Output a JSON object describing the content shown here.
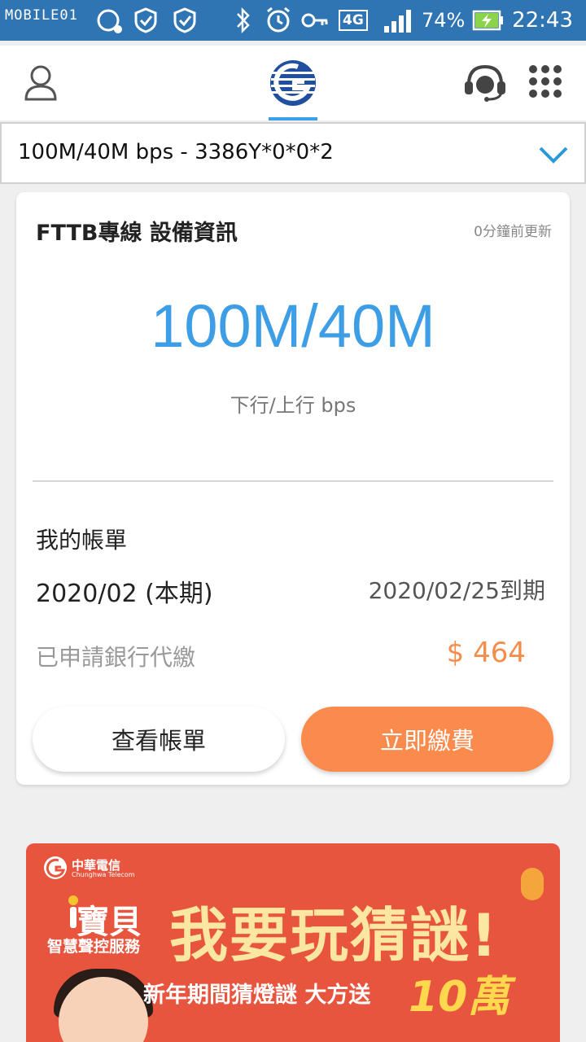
{
  "status_bar": {
    "watermark": "MOBILE01",
    "network": "4G",
    "battery": "74%",
    "time": "22:43"
  },
  "app_header": {
    "account_icon": "person-icon",
    "logo": "chunghwa-telecom-logo",
    "support_icon": "headset-icon",
    "menu_icon": "grid-menu-icon"
  },
  "plan_select": {
    "value": "100M/40M bps - 3386Y*0*0*2",
    "icon": "chevron-down-icon"
  },
  "device_card": {
    "title": "FTTB專線 設備資訊",
    "updated": "0分鐘前更新",
    "speed": "100M/40M",
    "speed_label": "下行/上行 bps"
  },
  "bill": {
    "title": "我的帳單",
    "period": "2020/02 (本期)",
    "due": "2020/02/25到期",
    "status": "已申請銀行代繳",
    "amount": "$ 464",
    "view_button": "查看帳單",
    "pay_button": "立即繳費"
  },
  "banner": {
    "brand": "中華電信",
    "brand_en": "Chunghwa Telecom",
    "product": "寶貝",
    "product_sub": "智慧聲控服務",
    "headline": "我要玩猜謎!",
    "sub": "新年期間猜燈謎 大方送",
    "big": "10萬"
  },
  "colors": {
    "status_bar": "#2f74b3",
    "accent_blue": "#3d9ee6",
    "accent_orange": "#fb8a4d",
    "banner_red": "#e8553e"
  }
}
